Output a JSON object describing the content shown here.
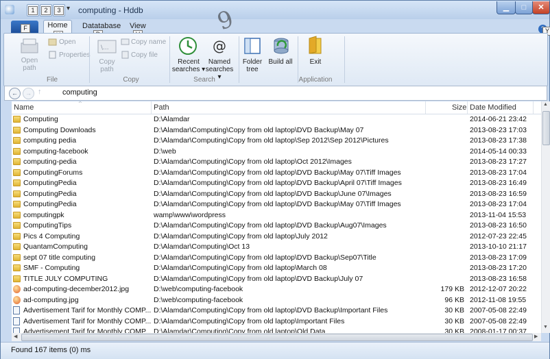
{
  "window": {
    "title": "computing - Hddb"
  },
  "keytips": {
    "qat1": "1",
    "qat2": "2",
    "qat3": "3",
    "file": "F",
    "home": "H",
    "database": "D",
    "view": "V",
    "help": "Y"
  },
  "tabs": {
    "file": "",
    "home": "Home",
    "database": "Datatabase",
    "view": "View"
  },
  "ribbon": {
    "open_path": "Open path",
    "open": "Open",
    "properties": "Properties",
    "copy_path": "Copy path",
    "copy_name": "Copy name",
    "copy_file": "Copy file",
    "recent_searches": "Recent searches ▾",
    "named_searches": "Named searches ▾",
    "folder_tree": "Folder tree",
    "build_all": "Build all",
    "exit": "Exit",
    "groups": {
      "file": "File",
      "copy": "Copy",
      "search": "Search",
      "application": "Application"
    }
  },
  "address": {
    "path": "computing"
  },
  "columns": {
    "name": "Name",
    "path": "Path",
    "size": "Size",
    "date": "Date Modified"
  },
  "rows": [
    {
      "type": "folder",
      "name": "Computing",
      "path": "D:\\Alamdar",
      "size": "",
      "date": "2014-06-21 23:42"
    },
    {
      "type": "folder",
      "name": "Computing Downloads",
      "path": "D:\\Alamdar\\Computing\\Copy from old laptop\\DVD Backup\\May 07",
      "size": "",
      "date": "2013-08-23 17:03"
    },
    {
      "type": "folder",
      "name": "computing pedia",
      "path": "D:\\Alamdar\\Computing\\Copy from old laptop\\Sep 2012\\Sep 2012\\Pictures",
      "size": "",
      "date": "2013-08-23 17:38"
    },
    {
      "type": "folder",
      "name": "computing-facebook",
      "path": "D:\\web",
      "size": "",
      "date": "2014-05-14 00:33"
    },
    {
      "type": "folder",
      "name": "computing-pedia",
      "path": "D:\\Alamdar\\Computing\\Copy from old laptop\\Oct 2012\\Images",
      "size": "",
      "date": "2013-08-23 17:27"
    },
    {
      "type": "folder",
      "name": "ComputingForums",
      "path": "D:\\Alamdar\\Computing\\Copy from old laptop\\DVD Backup\\May 07\\Tiff Images",
      "size": "",
      "date": "2013-08-23 17:04"
    },
    {
      "type": "folder",
      "name": "ComputingPedia",
      "path": "D:\\Alamdar\\Computing\\Copy from old laptop\\DVD Backup\\April 07\\Tiff Images",
      "size": "",
      "date": "2013-08-23 16:49"
    },
    {
      "type": "folder",
      "name": "ComputingPedia",
      "path": "D:\\Alamdar\\Computing\\Copy from old laptop\\DVD Backup\\June 07\\Images",
      "size": "",
      "date": "2013-08-23 16:59"
    },
    {
      "type": "folder",
      "name": "ComputingPedia",
      "path": "D:\\Alamdar\\Computing\\Copy from old laptop\\DVD Backup\\May 07\\Tiff Images",
      "size": "",
      "date": "2013-08-23 17:04"
    },
    {
      "type": "folder",
      "name": "computingpk",
      "path": "wamp\\www\\wordpress",
      "size": "",
      "date": "2013-11-04 15:53"
    },
    {
      "type": "folder",
      "name": "ComputingTips",
      "path": "D:\\Alamdar\\Computing\\Copy from old laptop\\DVD Backup\\Aug07\\Images",
      "size": "",
      "date": "2013-08-23 16:50"
    },
    {
      "type": "folder",
      "name": "Pics 4 Computing",
      "path": "D:\\Alamdar\\Computing\\Copy from old laptop\\July 2012",
      "size": "",
      "date": "2012-07-23 22:45"
    },
    {
      "type": "folder",
      "name": "QuantamComputing",
      "path": "D:\\Alamdar\\Computing\\Oct 13",
      "size": "",
      "date": "2013-10-10 21:17"
    },
    {
      "type": "folder",
      "name": "sept 07 title computing",
      "path": "D:\\Alamdar\\Computing\\Copy from old laptop\\DVD Backup\\Sep07\\Title",
      "size": "",
      "date": "2013-08-23 17:09"
    },
    {
      "type": "folder",
      "name": "SMF - Computing",
      "path": "D:\\Alamdar\\Computing\\Copy from old laptop\\March 08",
      "size": "",
      "date": "2013-08-23 17:20"
    },
    {
      "type": "folder",
      "name": "TITLE JULY COMPUTING",
      "path": "D:\\Alamdar\\Computing\\Copy from old laptop\\DVD Backup\\July 07",
      "size": "",
      "date": "2013-08-23 16:58"
    },
    {
      "type": "jpg",
      "name": "ad-computing-december2012.jpg",
      "path": "D:\\web\\computing-facebook",
      "size": "179 KB",
      "date": "2012-12-07 20:22"
    },
    {
      "type": "jpg",
      "name": "ad-computing.jpg",
      "path": "D:\\web\\computing-facebook",
      "size": "96 KB",
      "date": "2012-11-08 19:55"
    },
    {
      "type": "doc",
      "name": "Advertisement Tarif for Monthly COMP...",
      "path": "D:\\Alamdar\\Computing\\Copy from old laptop\\DVD Backup\\Important Files",
      "size": "30 KB",
      "date": "2007-05-08 22:49"
    },
    {
      "type": "doc",
      "name": "Advertisement Tarif for Monthly COMP...",
      "path": "D:\\Alamdar\\Computing\\Copy from old laptop\\Important Files",
      "size": "30 KB",
      "date": "2007-05-08 22:49"
    },
    {
      "type": "doc",
      "name": "Advertisement Tarif for Monthly COMP...",
      "path": "D:\\Alamdar\\Computing\\Copy from old laptop\\Old Data",
      "size": "30 KB",
      "date": "2008-01-17 00:37"
    }
  ],
  "status": {
    "text": "Found 167 items (0) ms"
  },
  "watermark": "9"
}
